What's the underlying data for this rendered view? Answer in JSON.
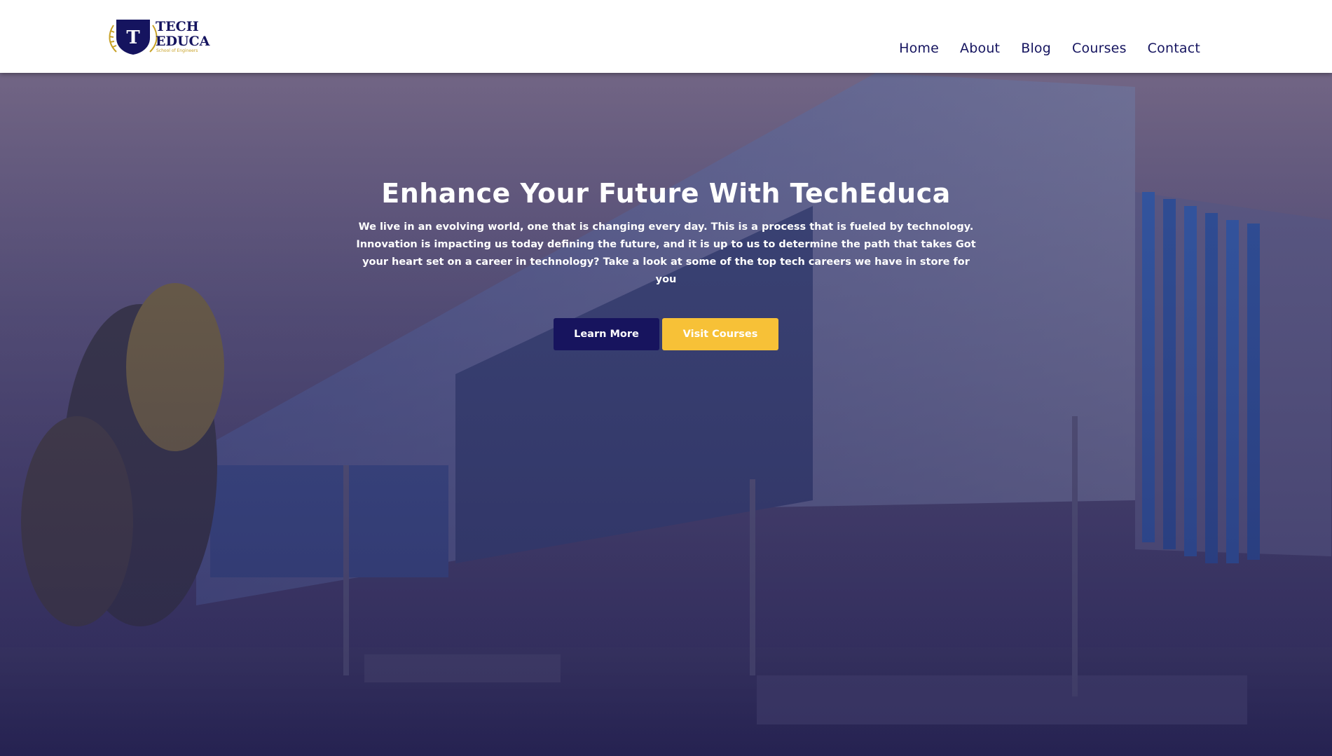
{
  "brand": {
    "name_line1": "TECH",
    "name_line2": "EDUCA",
    "badge_letter": "T",
    "tagline": "School of Engineers",
    "colors": {
      "navy": "#15145f",
      "gold": "#c8a227"
    }
  },
  "nav": {
    "items": [
      {
        "label": "Home"
      },
      {
        "label": "About"
      },
      {
        "label": "Blog"
      },
      {
        "label": "Courses"
      },
      {
        "label": "Contact"
      }
    ]
  },
  "hero": {
    "title": "Enhance Your Future With TechEduca",
    "text": "We live in an evolving world, one that is changing every day. This is a process that is fueled by technology. Innovation is impacting us today defining the future, and it is up to us to determine the path that takes Got your heart set on a career in technology? Take a look at some of the top tech careers we have in store for you",
    "primary_button": "Learn More",
    "secondary_button": "Visit Courses",
    "colors": {
      "primary": "#17145e",
      "secondary": "#f7c137",
      "overlay": "#2f2b57"
    }
  }
}
